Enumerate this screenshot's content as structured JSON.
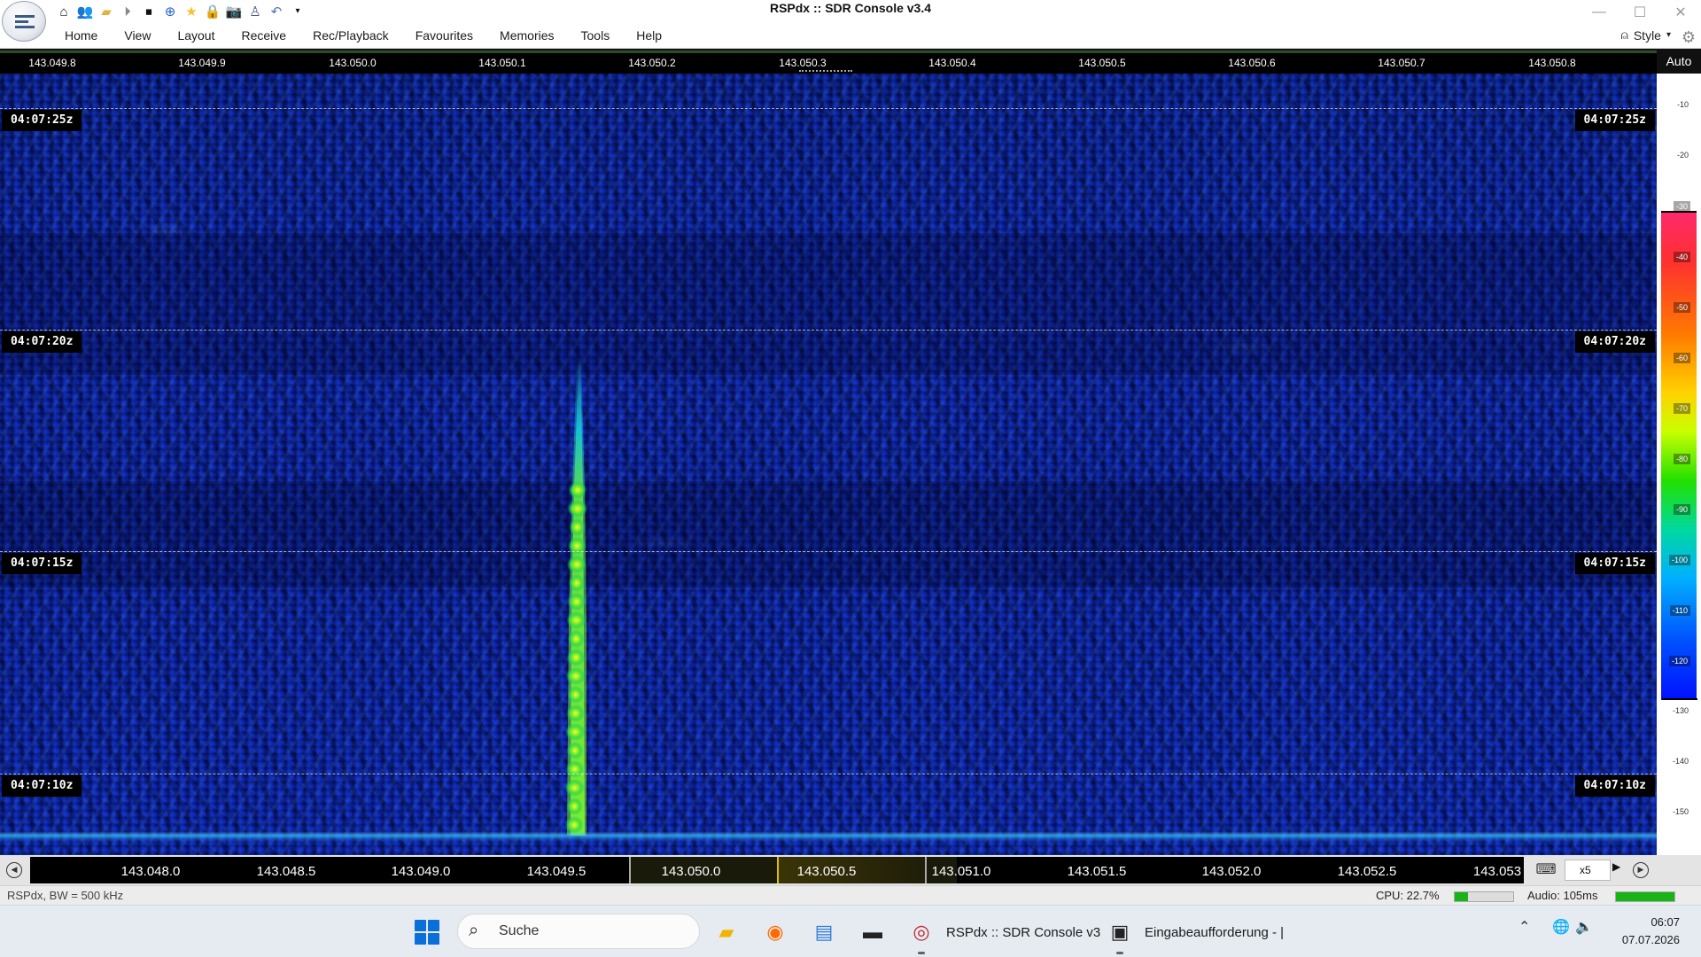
{
  "window": {
    "title": "RSPdx :: SDR Console v3.4",
    "quick_access": [
      "home-icon",
      "users-icon",
      "folder-icon",
      "play-icon",
      "stop-icon",
      "add-icon",
      "star-icon",
      "lock-icon",
      "camera-icon",
      "antenna-icon",
      "undo-icon",
      "dropdown-icon"
    ],
    "controls": {
      "minimize": "—",
      "maximize": "☐",
      "close": "✕"
    }
  },
  "menu": {
    "items": [
      "Home",
      "View",
      "Layout",
      "Receive",
      "Rec/Playback",
      "Favourites",
      "Memories",
      "Tools",
      "Help"
    ],
    "style_label": "Style"
  },
  "top_ruler": {
    "labels": [
      "143.049.8",
      "143.049.9",
      "143.050.0",
      "143.050.1",
      "143.050.2",
      "143.050.3",
      "143.050.4",
      "143.050.5",
      "143.050.6",
      "143.050.7",
      "143.050.8"
    ],
    "auto_label": "Auto"
  },
  "waterfall": {
    "timestamps": [
      "04:07:25z",
      "04:07:20z",
      "04:07:15z",
      "04:07:10z"
    ],
    "signal_frequency": "143.049.5",
    "colors": {
      "background": "#0a20a8",
      "signal_core": "#d8ff2a",
      "signal_edge": "#16c8d8",
      "floor": "#46c8ff"
    }
  },
  "color_scale": {
    "ticks": [
      "-10",
      "-20",
      "-30",
      "-40",
      "-50",
      "-60",
      "-70",
      "-80",
      "-90",
      "-100",
      "-110",
      "-120",
      "-130",
      "-140",
      "-150"
    ],
    "range_top": "-30",
    "range_bottom": "-120"
  },
  "bottom_ruler": {
    "labels": [
      "143.048.0",
      "143.048.5",
      "143.049.0",
      "143.049.5",
      "143.050.0",
      "143.050.5",
      "143.051.0",
      "143.051.5",
      "143.052.0",
      "143.052.5",
      "143.053"
    ],
    "zoom": "x5",
    "highlight_color": "#1e1a00"
  },
  "status": {
    "left": "RSPdx, BW = 500 kHz",
    "cpu": "CPU: 22.7%",
    "cpu_level": 0.227,
    "audio": "Audio: 105ms",
    "audio_level": 1.0
  },
  "taskbar": {
    "search_placeholder": "Suche",
    "apps": [
      {
        "icon": "file-explorer-icon",
        "label": ""
      },
      {
        "icon": "firefox-icon",
        "label": ""
      },
      {
        "icon": "notepad-icon",
        "label": ""
      },
      {
        "icon": "terminal-icon",
        "label": ""
      },
      {
        "icon": "sdr-console-icon",
        "label": "RSPdx :: SDR Console v3"
      },
      {
        "icon": "command-prompt-icon",
        "label": "Eingabeaufforderung - |"
      }
    ],
    "clock_time": "06:07",
    "clock_date": "07.07.2026"
  }
}
